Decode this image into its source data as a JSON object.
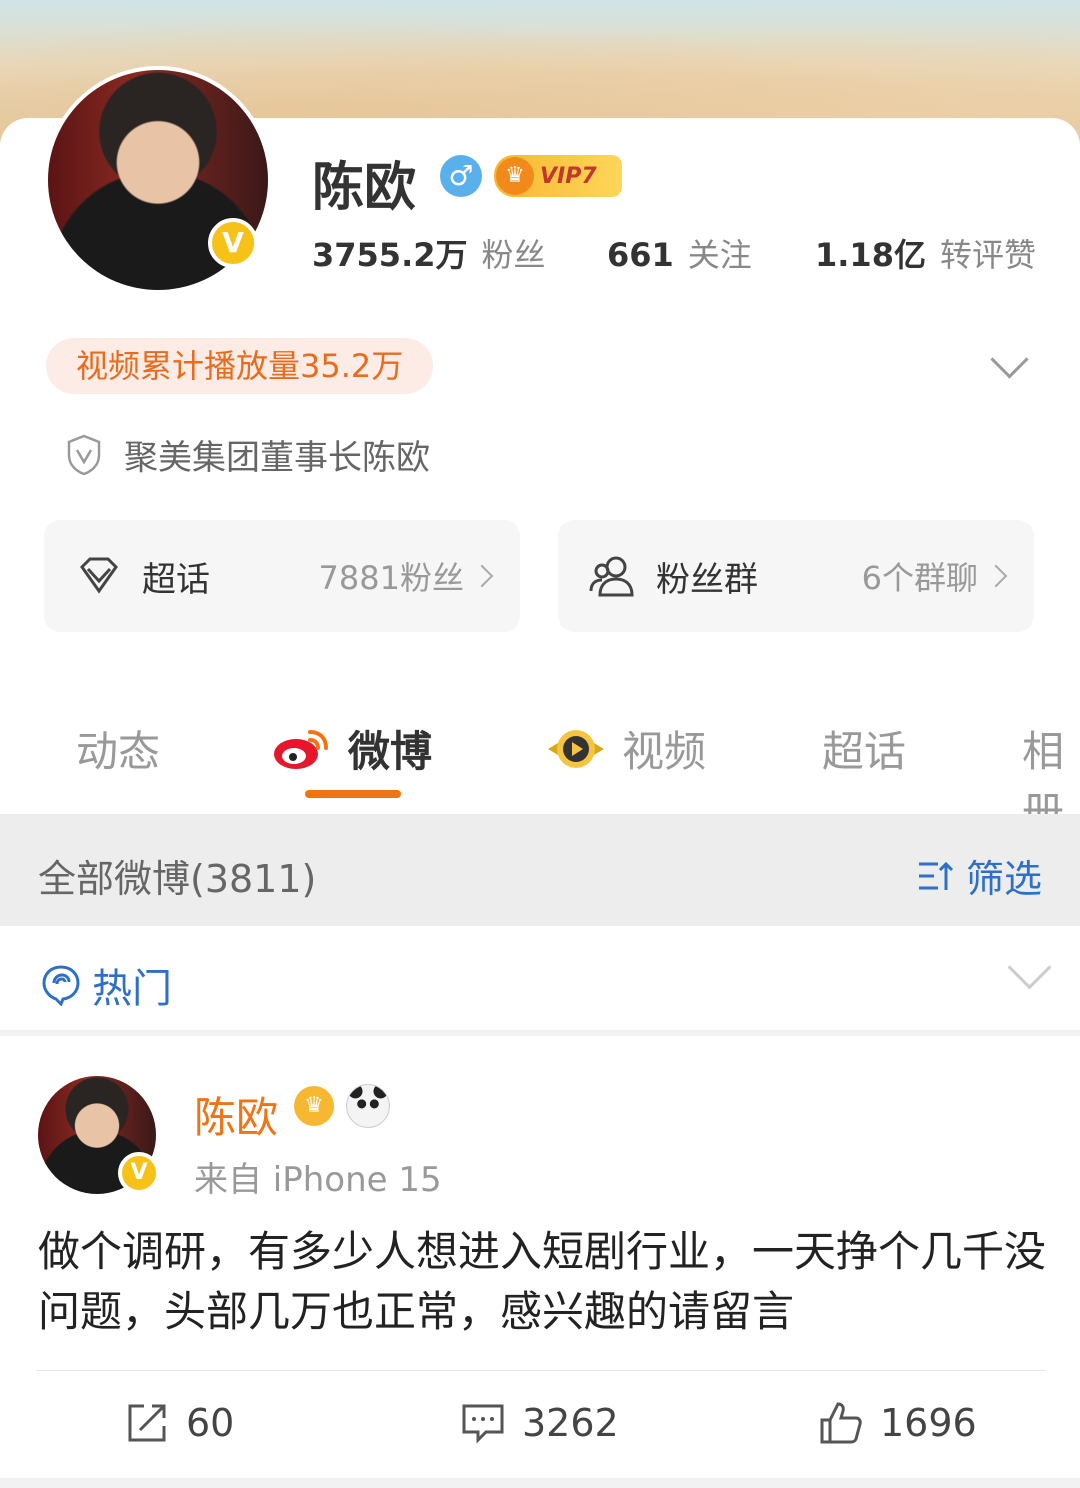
{
  "profile": {
    "name": "陈欧",
    "vip_label": "VIP7",
    "stats": [
      {
        "value": "3755.2万",
        "label": "粉丝"
      },
      {
        "value": "661",
        "label": "关注"
      },
      {
        "value": "1.18亿",
        "label": "转评赞"
      }
    ],
    "video_pill": "视频累计播放量35.2万",
    "certification": "聚美集团董事长陈欧",
    "tiles": [
      {
        "name": "超话",
        "value": "7881粉丝"
      },
      {
        "name": "粉丝群",
        "value": "6个群聊"
      }
    ]
  },
  "tabs": [
    "动态",
    "微博",
    "视频",
    "超话",
    "相册"
  ],
  "feed": {
    "all_label": "全部微博(3811)",
    "filter_label": "筛选",
    "hot_label": "热门"
  },
  "post": {
    "author": "陈欧",
    "source": "来自 iPhone 15",
    "text": "做个调研，有多少人想进入短剧行业，一天挣个几千没问题，头部几万也正常，感兴趣的请留言",
    "reposts": "60",
    "comments": "3262",
    "likes": "1696"
  },
  "colors": {
    "accent_orange": "#f07314",
    "link_blue": "#2e6fc7",
    "verified_yellow": "#f6c218"
  }
}
